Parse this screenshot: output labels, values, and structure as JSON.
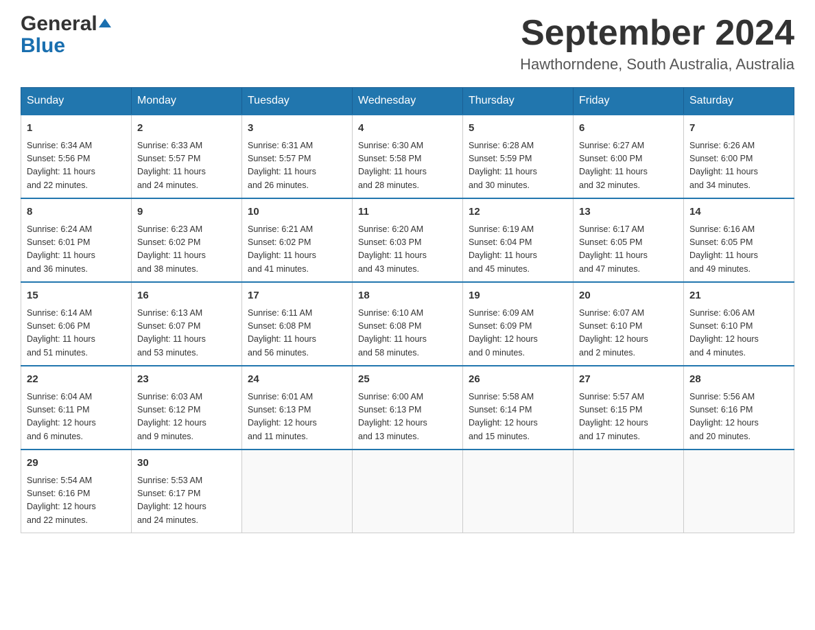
{
  "header": {
    "logo_general": "General",
    "logo_blue": "Blue",
    "month_title": "September 2024",
    "location": "Hawthorndene, South Australia, Australia"
  },
  "columns": [
    "Sunday",
    "Monday",
    "Tuesday",
    "Wednesday",
    "Thursday",
    "Friday",
    "Saturday"
  ],
  "weeks": [
    [
      {
        "day": "1",
        "info": "Sunrise: 6:34 AM\nSunset: 5:56 PM\nDaylight: 11 hours\nand 22 minutes."
      },
      {
        "day": "2",
        "info": "Sunrise: 6:33 AM\nSunset: 5:57 PM\nDaylight: 11 hours\nand 24 minutes."
      },
      {
        "day": "3",
        "info": "Sunrise: 6:31 AM\nSunset: 5:57 PM\nDaylight: 11 hours\nand 26 minutes."
      },
      {
        "day": "4",
        "info": "Sunrise: 6:30 AM\nSunset: 5:58 PM\nDaylight: 11 hours\nand 28 minutes."
      },
      {
        "day": "5",
        "info": "Sunrise: 6:28 AM\nSunset: 5:59 PM\nDaylight: 11 hours\nand 30 minutes."
      },
      {
        "day": "6",
        "info": "Sunrise: 6:27 AM\nSunset: 6:00 PM\nDaylight: 11 hours\nand 32 minutes."
      },
      {
        "day": "7",
        "info": "Sunrise: 6:26 AM\nSunset: 6:00 PM\nDaylight: 11 hours\nand 34 minutes."
      }
    ],
    [
      {
        "day": "8",
        "info": "Sunrise: 6:24 AM\nSunset: 6:01 PM\nDaylight: 11 hours\nand 36 minutes."
      },
      {
        "day": "9",
        "info": "Sunrise: 6:23 AM\nSunset: 6:02 PM\nDaylight: 11 hours\nand 38 minutes."
      },
      {
        "day": "10",
        "info": "Sunrise: 6:21 AM\nSunset: 6:02 PM\nDaylight: 11 hours\nand 41 minutes."
      },
      {
        "day": "11",
        "info": "Sunrise: 6:20 AM\nSunset: 6:03 PM\nDaylight: 11 hours\nand 43 minutes."
      },
      {
        "day": "12",
        "info": "Sunrise: 6:19 AM\nSunset: 6:04 PM\nDaylight: 11 hours\nand 45 minutes."
      },
      {
        "day": "13",
        "info": "Sunrise: 6:17 AM\nSunset: 6:05 PM\nDaylight: 11 hours\nand 47 minutes."
      },
      {
        "day": "14",
        "info": "Sunrise: 6:16 AM\nSunset: 6:05 PM\nDaylight: 11 hours\nand 49 minutes."
      }
    ],
    [
      {
        "day": "15",
        "info": "Sunrise: 6:14 AM\nSunset: 6:06 PM\nDaylight: 11 hours\nand 51 minutes."
      },
      {
        "day": "16",
        "info": "Sunrise: 6:13 AM\nSunset: 6:07 PM\nDaylight: 11 hours\nand 53 minutes."
      },
      {
        "day": "17",
        "info": "Sunrise: 6:11 AM\nSunset: 6:08 PM\nDaylight: 11 hours\nand 56 minutes."
      },
      {
        "day": "18",
        "info": "Sunrise: 6:10 AM\nSunset: 6:08 PM\nDaylight: 11 hours\nand 58 minutes."
      },
      {
        "day": "19",
        "info": "Sunrise: 6:09 AM\nSunset: 6:09 PM\nDaylight: 12 hours\nand 0 minutes."
      },
      {
        "day": "20",
        "info": "Sunrise: 6:07 AM\nSunset: 6:10 PM\nDaylight: 12 hours\nand 2 minutes."
      },
      {
        "day": "21",
        "info": "Sunrise: 6:06 AM\nSunset: 6:10 PM\nDaylight: 12 hours\nand 4 minutes."
      }
    ],
    [
      {
        "day": "22",
        "info": "Sunrise: 6:04 AM\nSunset: 6:11 PM\nDaylight: 12 hours\nand 6 minutes."
      },
      {
        "day": "23",
        "info": "Sunrise: 6:03 AM\nSunset: 6:12 PM\nDaylight: 12 hours\nand 9 minutes."
      },
      {
        "day": "24",
        "info": "Sunrise: 6:01 AM\nSunset: 6:13 PM\nDaylight: 12 hours\nand 11 minutes."
      },
      {
        "day": "25",
        "info": "Sunrise: 6:00 AM\nSunset: 6:13 PM\nDaylight: 12 hours\nand 13 minutes."
      },
      {
        "day": "26",
        "info": "Sunrise: 5:58 AM\nSunset: 6:14 PM\nDaylight: 12 hours\nand 15 minutes."
      },
      {
        "day": "27",
        "info": "Sunrise: 5:57 AM\nSunset: 6:15 PM\nDaylight: 12 hours\nand 17 minutes."
      },
      {
        "day": "28",
        "info": "Sunrise: 5:56 AM\nSunset: 6:16 PM\nDaylight: 12 hours\nand 20 minutes."
      }
    ],
    [
      {
        "day": "29",
        "info": "Sunrise: 5:54 AM\nSunset: 6:16 PM\nDaylight: 12 hours\nand 22 minutes."
      },
      {
        "day": "30",
        "info": "Sunrise: 5:53 AM\nSunset: 6:17 PM\nDaylight: 12 hours\nand 24 minutes."
      },
      {
        "day": "",
        "info": ""
      },
      {
        "day": "",
        "info": ""
      },
      {
        "day": "",
        "info": ""
      },
      {
        "day": "",
        "info": ""
      },
      {
        "day": "",
        "info": ""
      }
    ]
  ]
}
